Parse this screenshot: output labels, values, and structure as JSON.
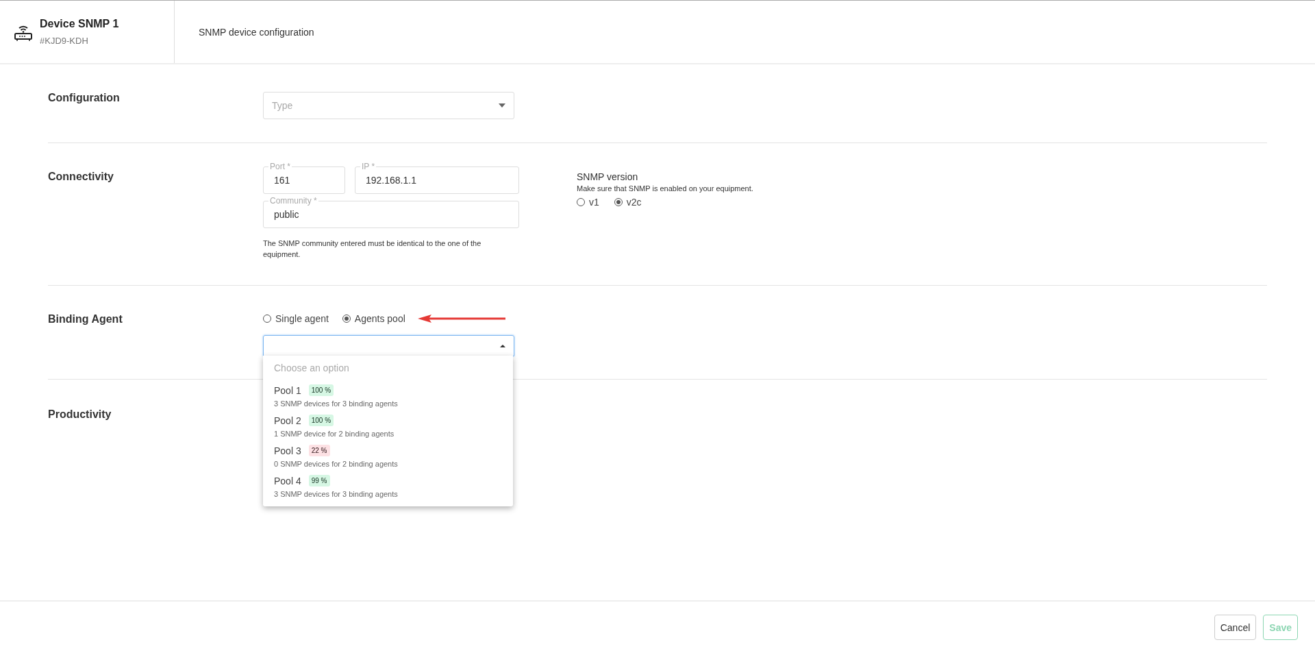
{
  "header": {
    "title": "Device SNMP 1",
    "subtitle": "#KJD9-KDH",
    "description": "SNMP device configuration"
  },
  "sections": [
    {
      "kind": "configuration",
      "label": "Configuration",
      "select": {
        "placeholder": "Type"
      }
    },
    {
      "kind": "connectivity",
      "label": "Connectivity",
      "port": {
        "label": "Port *",
        "value": "161"
      },
      "ip": {
        "label": "IP *",
        "value": "192.168.1.1"
      },
      "community": {
        "label": "Community *",
        "value": "public"
      },
      "hint": "The SNMP community entered must be identical to the one of the equipment.",
      "version": {
        "title": "SNMP version",
        "note": "Make sure that SNMP is enabled on your equipment.",
        "options": [
          {
            "label": "v1",
            "selected": false
          },
          {
            "label": "v2c",
            "selected": true
          }
        ]
      }
    },
    {
      "kind": "binding",
      "label": "Binding Agent",
      "options": [
        {
          "label": "Single agent",
          "selected": false
        },
        {
          "label": "Agents pool",
          "selected": true
        }
      ],
      "dropdown": {
        "expanded": true,
        "placeholder": "Choose an option",
        "items": [
          {
            "name": "Pool 1",
            "badge": "100 %",
            "color": "#d6f7e4",
            "detail": "3 SNMP devices for 3 binding agents"
          },
          {
            "name": "Pool 2",
            "badge": "100 %",
            "color": "#d6f7e4",
            "detail": "1 SNMP device for 2 binding agents"
          },
          {
            "name": "Pool 3",
            "badge": "22 %",
            "color": "#fde1e4",
            "detail": "0 SNMP devices for 2 binding agents"
          },
          {
            "name": "Pool 4",
            "badge": "99 %",
            "color": "#d6f7e4",
            "detail": "3 SNMP devices for 3 binding agents"
          }
        ]
      }
    },
    {
      "kind": "productivity",
      "label": "Productivity"
    }
  ],
  "footer": {
    "buttons": [
      {
        "label": "Cancel",
        "kind": "secondary",
        "disabled": false
      },
      {
        "label": "Save",
        "kind": "primary",
        "disabled": true
      }
    ]
  }
}
